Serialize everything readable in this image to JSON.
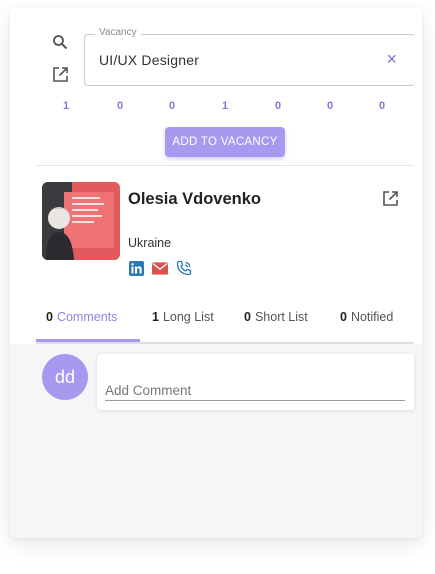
{
  "vacancy": {
    "legend": "Vacancy",
    "value": "UI/UX Designer",
    "clear_symbol": "×"
  },
  "icons": {
    "search": "search-icon",
    "open_external": "open-external-icon",
    "linkedin": "linkedin-icon",
    "email": "email-icon",
    "phone": "phone-icon"
  },
  "counts": [
    "1",
    "0",
    "0",
    "1",
    "0",
    "0",
    "0"
  ],
  "add_button_label": "ADD TO VACANCY",
  "candidate": {
    "name": "Olesia Vdovenko",
    "location": "Ukraine"
  },
  "tabs": [
    {
      "count": "0",
      "label": "Comments"
    },
    {
      "count": "1",
      "label": "Long List"
    },
    {
      "count": "0",
      "label": "Short List"
    },
    {
      "count": "0",
      "label": "Notified"
    }
  ],
  "user": {
    "initials": "dd"
  },
  "comment": {
    "placeholder": "Add Comment"
  },
  "colors": {
    "accent": "#a59af0",
    "accent_text": "#8279d6",
    "linkedin": "#2a78b5",
    "email": "#d9534f",
    "phone": "#2a78b5"
  }
}
